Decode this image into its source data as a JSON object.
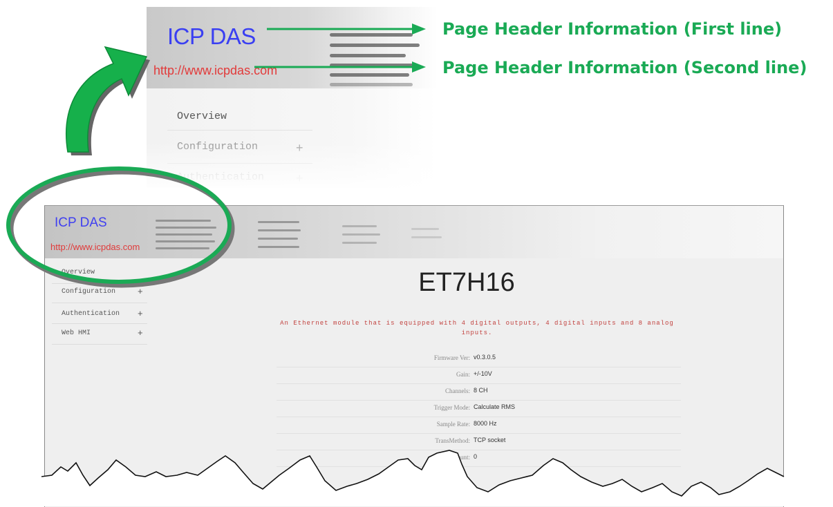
{
  "annotations": {
    "first_line": "Page Header Information (First line)",
    "second_line": "Page Header Information (Second line)",
    "color": "#1aaa55"
  },
  "header": {
    "title": "ICP DAS",
    "url": "http://www.icpdas.com",
    "title_color": "#3a3ff2",
    "url_color": "#e23a3a"
  },
  "zoom_nav": {
    "overview": "Overview",
    "configuration": "Configuration",
    "authentication": "Authentication",
    "plus": "+"
  },
  "sidebar": {
    "items": [
      {
        "label": "Overview",
        "expandable": false
      },
      {
        "label": "Configuration",
        "expandable": true
      },
      {
        "label": "Authentication",
        "expandable": true
      },
      {
        "label": "Web HMI",
        "expandable": true
      }
    ],
    "plus": "+"
  },
  "device": {
    "name": "ET7H16",
    "description": "An Ethernet module that is equipped with 4 digital outputs, 4 digital inputs and 8 analog inputs."
  },
  "specs": [
    {
      "key": "Firmware Ver:",
      "value": "v0.3.0.5"
    },
    {
      "key": "Gain:",
      "value": "+/-10V"
    },
    {
      "key": "Channels:",
      "value": "8 CH"
    },
    {
      "key": "Trigger Mode:",
      "value": "Calculate RMS"
    },
    {
      "key": "Sample Rate:",
      "value": "8000 Hz"
    },
    {
      "key": "TransMethod:",
      "value": "TCP socket"
    },
    {
      "key": "Sample Count:",
      "value": "0"
    }
  ]
}
